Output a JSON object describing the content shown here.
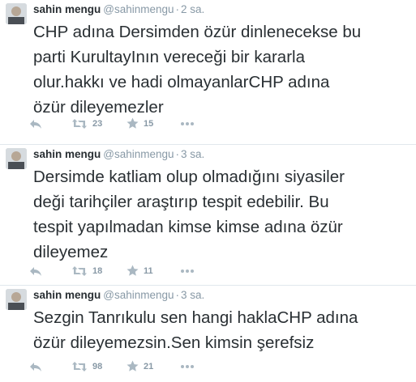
{
  "colors": {
    "name": "#292f33",
    "meta": "#8899a6",
    "icon": "#aab8c2",
    "divider": "#e1e8ed"
  },
  "icons": [
    "reply-icon",
    "retweet-icon",
    "favorite-icon",
    "more-icon"
  ],
  "tweets": [
    {
      "name": "sahin mengu",
      "handle": "@sahinmengu",
      "separator": "·",
      "time": "2 sa.",
      "text": "CHP adına Dersimden özür dinlenecekse bu\nparti KurultayInın vereceği bir kararla\nolur.hakkı ve hadi olmayanlarCHP adına\nözür dileyemezler",
      "retweets": "23",
      "favorites": "15"
    },
    {
      "name": "sahin mengu",
      "handle": "@sahinmengu",
      "separator": "·",
      "time": "3 sa.",
      "text": "Dersimde katliam olup olmadığını siyasiler\ndeği tarihçiler araştırıp tespit edebilir. Bu\ntespit yapılmadan kimse kimse adına özür\ndileyemez",
      "retweets": "18",
      "favorites": "11"
    },
    {
      "name": "sahin mengu",
      "handle": "@sahinmengu",
      "separator": "·",
      "time": "3 sa.",
      "text": "Sezgin Tanrıkulu sen hangi haklaCHP adına\nözür dileyemezsin.Sen kimsin şerefsiz",
      "retweets": "98",
      "favorites": "21"
    }
  ]
}
